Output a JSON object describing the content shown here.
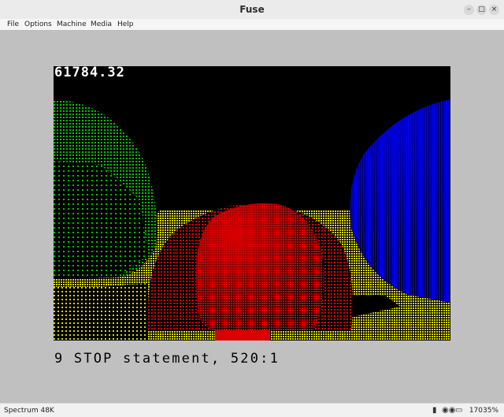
{
  "window": {
    "title": "Fuse"
  },
  "window_controls": {
    "minimize": "–",
    "maximize": "□",
    "close": "×"
  },
  "menu": {
    "file": "File",
    "options": "Options",
    "machine": "Machine",
    "media": "Media",
    "help": "Help"
  },
  "screen": {
    "counter": "61784.32",
    "message": "9 STOP statement, 520:1",
    "colors": {
      "border": "#c0c0c0",
      "paper": "#000000",
      "red": "#d80000",
      "green": "#00c000",
      "blue": "#0000d8",
      "yellow": "#d8d800"
    }
  },
  "statusbar": {
    "machine": "Spectrum 48K",
    "speed": "17035%",
    "icons": [
      "disk-icon",
      "tape-icon",
      "microdrive-icon"
    ]
  }
}
